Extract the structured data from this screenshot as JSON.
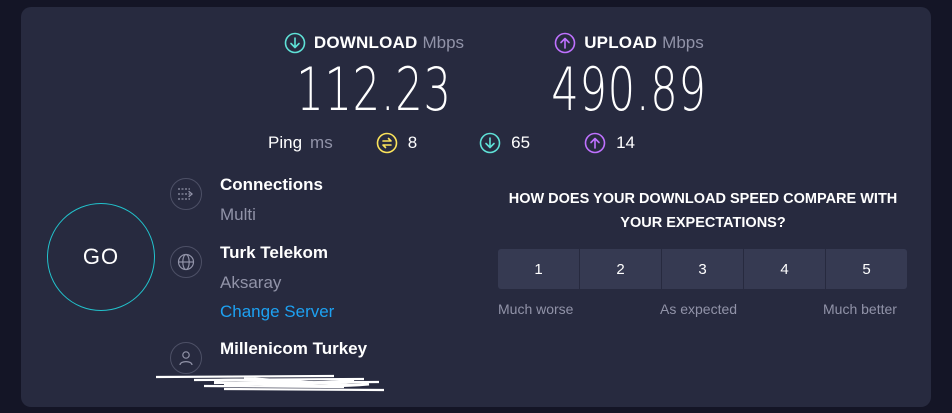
{
  "download": {
    "title": "DOWNLOAD",
    "unit": "Mbps",
    "value": "112.23",
    "color": "#5fe1d7"
  },
  "upload": {
    "title": "UPLOAD",
    "unit": "Mbps",
    "value": "490.89",
    "color": "#bf71ff"
  },
  "ping": {
    "label": "Ping",
    "unit": "ms",
    "idle": "8",
    "download": "65",
    "upload": "14",
    "idle_color": "#fbe35b"
  },
  "go_button": {
    "label": "GO",
    "color": "#22c2cc"
  },
  "connections": {
    "title": "Connections",
    "value": "Multi"
  },
  "server": {
    "title": "Turk Telekom",
    "location": "Aksaray",
    "change_label": "Change Server"
  },
  "provider": {
    "title": "Millenicom Turkey"
  },
  "survey": {
    "question": "HOW DOES YOUR DOWNLOAD SPEED COMPARE WITH YOUR EXPECTATIONS?",
    "options": [
      "1",
      "2",
      "3",
      "4",
      "5"
    ],
    "low_label": "Much worse",
    "mid_label": "As expected",
    "high_label": "Much better"
  }
}
